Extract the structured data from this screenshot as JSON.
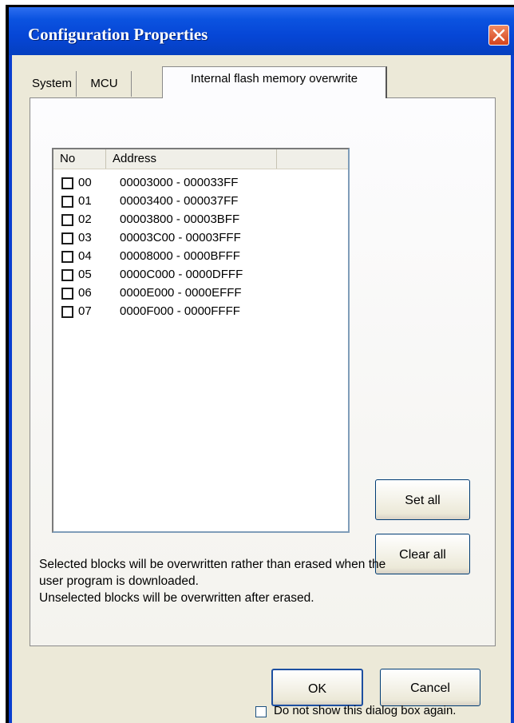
{
  "window": {
    "title": "Configuration Properties"
  },
  "tabs": [
    {
      "label": "System"
    },
    {
      "label": "MCU"
    },
    {
      "label": "Internal flash memory overwrite"
    }
  ],
  "list": {
    "headers": [
      "No",
      "Address"
    ],
    "rows": [
      {
        "no": "00",
        "address": "00003000 - 000033FF"
      },
      {
        "no": "01",
        "address": "00003400 - 000037FF"
      },
      {
        "no": "02",
        "address": "00003800 - 00003BFF"
      },
      {
        "no": "03",
        "address": "00003C00 - 00003FFF"
      },
      {
        "no": "04",
        "address": "00008000 - 0000BFFF"
      },
      {
        "no": "05",
        "address": "0000C000 - 0000DFFF"
      },
      {
        "no": "06",
        "address": "0000E000 - 0000EFFF"
      },
      {
        "no": "07",
        "address": "0000F000 - 0000FFFF"
      }
    ]
  },
  "buttons": {
    "set_all": "Set all",
    "clear_all": "Clear all",
    "ok": "OK",
    "cancel": "Cancel"
  },
  "note": "Selected blocks will be overwritten rather than erased when the\nuser program is downloaded.\nUnselected blocks will be overwritten after erased.",
  "do_not_show": "Do not show this dialog box again.",
  "colors": {
    "titlebar": "#0b53e0",
    "dialog_bg": "#ece9d8",
    "close_button": "#d4431d"
  }
}
